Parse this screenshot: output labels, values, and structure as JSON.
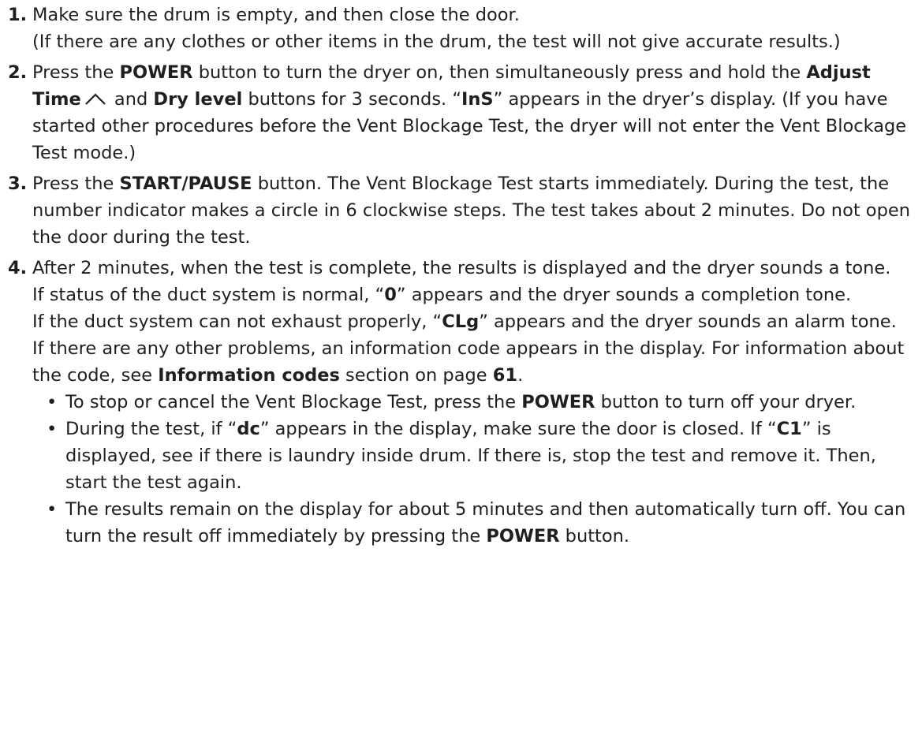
{
  "steps": [
    {
      "num": "1.",
      "lines": [
        "Make sure the drum is empty, and then close the door.",
        "(If there are any clothes or other items in the drum, the test will not give accurate results.)"
      ]
    },
    {
      "num": "2.",
      "t1": "Press the ",
      "b1": "POWER",
      "t2": " button to turn the dryer on, then simultaneously press and hold the ",
      "b2": "Adjust Time",
      "t3": " and ",
      "b3": "Dry level",
      "t4": " buttons for 3 seconds. “",
      "b4": "InS",
      "t5": "” appears in the dryer’s display. (If you have started other procedures before the Vent Blockage Test, the dryer will not enter the Vent Blockage Test mode.)"
    },
    {
      "num": "3.",
      "t1": "Press the ",
      "b1": "START/PAUSE",
      "t2": " button. The Vent Blockage Test starts immediately. During the test, the number indicator makes a circle in 6 clockwise steps. The test takes about 2 minutes. Do not open the door during the test."
    },
    {
      "num": "4.",
      "p1": "After 2 minutes, when the test is complete, the results is displayed and the dryer sounds a tone.",
      "p2a": "If status of the duct system is normal, “",
      "p2b": "0",
      "p2c": "” appears and the dryer sounds a completion tone.",
      "p3a": "If the duct system can not exhaust properly, “",
      "p3b": "CLg",
      "p3c": "” appears and the dryer sounds an alarm tone.",
      "p4a": "If there are any other problems, an information code appears in the display. For information about the code, see ",
      "p4b": "Information codes",
      "p4c": " section on page ",
      "p4d": "61",
      "p4e": ".",
      "bullets": [
        {
          "a": "To stop or cancel the Vent Blockage Test, press the ",
          "b": "POWER",
          "c": " button to turn off your dryer."
        },
        {
          "a": "During the test, if “",
          "b": "dc",
          "c": "” appears in the display, make sure the door is closed. If “",
          "d": "C1",
          "e": "” is displayed, see if there is laundry inside drum. If there is, stop the test and remove it. Then, start the test again."
        },
        {
          "a": "The results remain on the display for about 5 minutes and then automatically turn off. You can turn the result off immediately by pressing the ",
          "b": "POWER",
          "c": " button."
        }
      ]
    }
  ],
  "bullet_glyph": "•",
  "icons": {
    "adjust_time_up": "chevron-up-icon"
  }
}
